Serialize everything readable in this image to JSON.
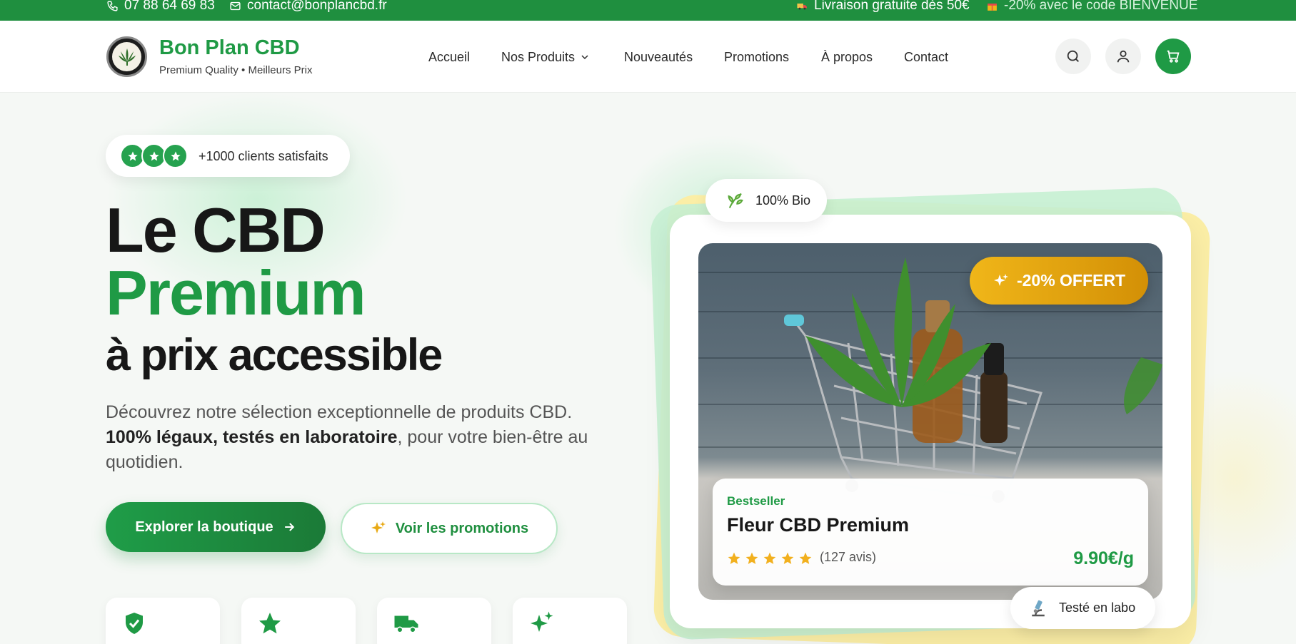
{
  "topbar": {
    "phone": "07 88 64 69 83",
    "email": "contact@bonplancbd.fr",
    "shipping": "Livraison gratuite dès 50€",
    "promo": "-20% avec le code BIENVENUE"
  },
  "header": {
    "brand_name": "Bon Plan CBD",
    "tagline": "Premium Quality • Meilleurs Prix",
    "nav": {
      "home": "Accueil",
      "products": "Nos Produits",
      "new": "Nouveautés",
      "promotions": "Promotions",
      "about": "À propos",
      "contact": "Contact"
    },
    "icons": {
      "search": "search-icon",
      "account": "user-icon",
      "cart": "cart-icon"
    }
  },
  "hero": {
    "rating_text": "+1000 clients satisfaits",
    "title_line1": "Le CBD",
    "title_line2": "Premium",
    "title_line3": "à prix accessible",
    "desc_part1": "Découvrez notre sélection exceptionnelle de produits CBD.",
    "desc_bold": "100% légaux, testés en laboratoire",
    "desc_part2": ", pour votre bien-être au quotidien.",
    "cta_primary": "Explorer la boutique",
    "cta_secondary": "Voir les promotions",
    "features": [
      "shield-check-icon",
      "star-icon",
      "truck-icon",
      "sparkles-icon"
    ]
  },
  "product_card": {
    "badge_bio": "100% Bio",
    "offer": "-20% OFFERT",
    "tag": "Bestseller",
    "title": "Fleur CBD Premium",
    "rating": 5,
    "reviews": "(127 avis)",
    "price": "9.90€/g",
    "badge_lab": "Testé en labo"
  },
  "colors": {
    "brand_green": "#1f9a45",
    "topbar_green": "#1f8f3f",
    "accent_gold": "#f0b619",
    "star_gold": "#f2b01e"
  }
}
